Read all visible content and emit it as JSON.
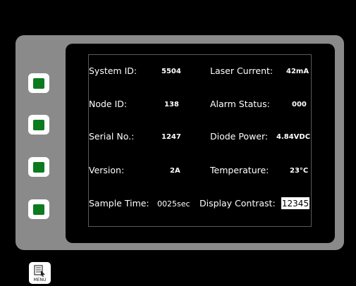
{
  "side_buttons": [
    {
      "name": "softkey-1"
    },
    {
      "name": "softkey-2"
    },
    {
      "name": "softkey-3"
    },
    {
      "name": "softkey-4"
    }
  ],
  "left_column": [
    {
      "label": "System ID:",
      "value": "5504"
    },
    {
      "label": "Node ID:",
      "value": "138"
    },
    {
      "label": "Serial No.:",
      "value": "1247"
    },
    {
      "label": "Version:",
      "value": "2A"
    },
    {
      "label": "Sample Time:",
      "value": "0025sec"
    }
  ],
  "right_column": [
    {
      "label": "Laser Current:",
      "value": "42mA"
    },
    {
      "label": "Alarm Status:",
      "value": "000"
    },
    {
      "label": "Diode Power:",
      "value": "4.84VDC"
    },
    {
      "label": "Temperature:",
      "value": "23°C"
    },
    {
      "label": "Display Contrast:",
      "value": "12345"
    }
  ],
  "menu": {
    "label": "MENU",
    "icon": "menu-icon"
  },
  "colors": {
    "bezel": "#8a8a8a",
    "led": "#0c7a1e",
    "screen_text": "#ffffff",
    "background": "#000000"
  }
}
